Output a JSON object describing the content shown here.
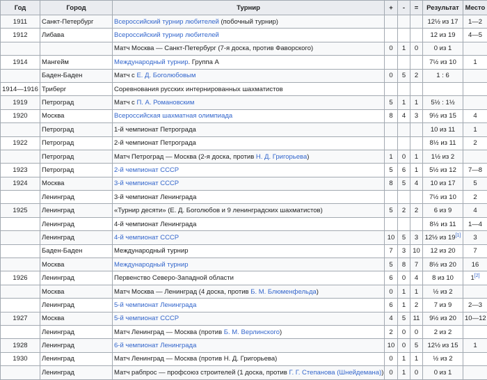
{
  "table": {
    "headers": [
      "Год",
      "Город",
      "Турнир",
      "+",
      "-",
      "=",
      "Результат",
      "Место"
    ],
    "rows": [
      {
        "year": "1911",
        "city": "Санкт-Петербург",
        "tournament": [
          {
            "t": "Всероссийский турнир любителей",
            "link": true
          },
          {
            "t": " (побочный турнир)"
          }
        ],
        "plus": "",
        "minus": "",
        "eq": "",
        "result": "12½ из 17",
        "place": [
          {
            "t": "1—2"
          }
        ]
      },
      {
        "year": "1912",
        "city": "Либава",
        "tournament": [
          {
            "t": "Всероссийский турнир любителей",
            "link": true
          }
        ],
        "plus": "",
        "minus": "",
        "eq": "",
        "result": "12 из 19",
        "place": [
          {
            "t": "4—5"
          }
        ]
      },
      {
        "year": "",
        "city": "",
        "tournament": [
          {
            "t": "Матч Москва — Санкт-Петербург (7-я доска, против Фаворского)"
          }
        ],
        "plus": "0",
        "minus": "1",
        "eq": "0",
        "result": "0 из 1",
        "place": [
          {
            "t": ""
          }
        ]
      },
      {
        "year": "1914",
        "city": "Мангейм",
        "tournament": [
          {
            "t": "Международный турнир",
            "link": true
          },
          {
            "t": ". Группа А"
          }
        ],
        "plus": "",
        "minus": "",
        "eq": "",
        "result": "7½ из 10",
        "place": [
          {
            "t": "1"
          }
        ]
      },
      {
        "year": "",
        "city": "Баден-Баден",
        "tournament": [
          {
            "t": "Матч с "
          },
          {
            "t": "Е. Д. Боголюбовым",
            "link": true
          }
        ],
        "plus": "0",
        "minus": "5",
        "eq": "2",
        "result": "1 : 6",
        "place": [
          {
            "t": ""
          }
        ]
      },
      {
        "year": "1914—1916",
        "city": "Триберг",
        "tournament": [
          {
            "t": "Соревнования русских интернированных шахматистов"
          }
        ],
        "plus": "",
        "minus": "",
        "eq": "",
        "result": "",
        "place": [
          {
            "t": ""
          }
        ]
      },
      {
        "year": "1919",
        "city": "Петроград",
        "tournament": [
          {
            "t": "Матч с "
          },
          {
            "t": "П. А. Романовским",
            "link": true
          }
        ],
        "plus": "5",
        "minus": "1",
        "eq": "1",
        "result": "5½ : 1½",
        "place": [
          {
            "t": ""
          }
        ]
      },
      {
        "year": "1920",
        "city": "Москва",
        "tournament": [
          {
            "t": "Всероссийская шахматная олимпиада",
            "link": true
          }
        ],
        "plus": "8",
        "minus": "4",
        "eq": "3",
        "result": "9½ из 15",
        "place": [
          {
            "t": "4"
          }
        ]
      },
      {
        "year": "",
        "city": "Петроград",
        "tournament": [
          {
            "t": "1-й чемпионат Петрограда"
          }
        ],
        "plus": "",
        "minus": "",
        "eq": "",
        "result": "10 из 11",
        "place": [
          {
            "t": "1"
          }
        ]
      },
      {
        "year": "1922",
        "city": "Петроград",
        "tournament": [
          {
            "t": "2-й чемпионат Петрограда"
          }
        ],
        "plus": "",
        "minus": "",
        "eq": "",
        "result": "8½ из 11",
        "place": [
          {
            "t": "2"
          }
        ]
      },
      {
        "year": "",
        "city": "Петроград",
        "tournament": [
          {
            "t": "Матч Петроград — Москва (2-я доска, против "
          },
          {
            "t": "Н. Д. Григорьева",
            "link": true
          },
          {
            "t": ")"
          }
        ],
        "plus": "1",
        "minus": "0",
        "eq": "1",
        "result": "1½ из 2",
        "place": [
          {
            "t": ""
          }
        ]
      },
      {
        "year": "1923",
        "city": "Петроград",
        "tournament": [
          {
            "t": "2-й чемпионат СССР",
            "link": true
          }
        ],
        "plus": "5",
        "minus": "6",
        "eq": "1",
        "result": "5½ из 12",
        "place": [
          {
            "t": "7—8"
          }
        ]
      },
      {
        "year": "1924",
        "city": "Москва",
        "tournament": [
          {
            "t": "3-й чемпионат СССР",
            "link": true
          }
        ],
        "plus": "8",
        "minus": "5",
        "eq": "4",
        "result": "10 из 17",
        "place": [
          {
            "t": "5"
          }
        ]
      },
      {
        "year": "",
        "city": "Ленинград",
        "tournament": [
          {
            "t": "3-й чемпионат Ленинграда"
          }
        ],
        "plus": "",
        "minus": "",
        "eq": "",
        "result": "7½ из 10",
        "place": [
          {
            "t": "2"
          }
        ]
      },
      {
        "year": "1925",
        "city": "Ленинград",
        "tournament": [
          {
            "t": "«Турнир десяти» (Е. Д. Боголюбов и 9 ленинградских шахматистов)"
          }
        ],
        "plus": "5",
        "minus": "2",
        "eq": "2",
        "result": "6 из 9",
        "place": [
          {
            "t": "4"
          }
        ]
      },
      {
        "year": "",
        "city": "Ленинград",
        "tournament": [
          {
            "t": "4-й чемпионат Ленинграда"
          }
        ],
        "plus": "",
        "minus": "",
        "eq": "",
        "result": "8½ из 11",
        "place": [
          {
            "t": "1—4"
          }
        ]
      },
      {
        "year": "",
        "city": "Ленинград",
        "tournament": [
          {
            "t": "4-й чемпионат СССР",
            "link": true
          }
        ],
        "plus": "10",
        "minus": "5",
        "eq": "3",
        "result": "12½ из 19",
        "result_ref": "[1]",
        "place": [
          {
            "t": "3"
          }
        ]
      },
      {
        "year": "",
        "city": "Баден-Баден",
        "tournament": [
          {
            "t": "Международный турнир"
          }
        ],
        "plus": "7",
        "minus": "3",
        "eq": "10",
        "result": "12 из 20",
        "place": [
          {
            "t": "7"
          }
        ]
      },
      {
        "year": "",
        "city": "Москва",
        "tournament": [
          {
            "t": "Международный турнир",
            "link": true
          }
        ],
        "plus": "5",
        "minus": "8",
        "eq": "7",
        "result": "8½ из 20",
        "place": [
          {
            "t": "16"
          }
        ]
      },
      {
        "year": "1926",
        "city": "Ленинград",
        "tournament": [
          {
            "t": "Первенство Северо-Западной области"
          }
        ],
        "plus": "6",
        "minus": "0",
        "eq": "4",
        "result": "8 из 10",
        "place": [
          {
            "t": "1"
          },
          {
            "t": "[2]",
            "ref": true
          }
        ]
      },
      {
        "year": "",
        "city": "Москва",
        "tournament": [
          {
            "t": "Матч Москва — Ленинград (4 доска, против "
          },
          {
            "t": "Б. М. Блюменфельда",
            "link": true
          },
          {
            "t": ")"
          }
        ],
        "plus": "0",
        "minus": "1",
        "eq": "1",
        "result": "½ из 2",
        "place": [
          {
            "t": ""
          }
        ]
      },
      {
        "year": "",
        "city": "Ленинград",
        "tournament": [
          {
            "t": "5-й чемпионат Ленинграда",
            "link": true
          }
        ],
        "plus": "6",
        "minus": "1",
        "eq": "2",
        "result": "7 из 9",
        "place": [
          {
            "t": "2—3"
          }
        ]
      },
      {
        "year": "1927",
        "city": "Москва",
        "tournament": [
          {
            "t": "5-й чемпионат СССР",
            "link": true
          }
        ],
        "plus": "4",
        "minus": "5",
        "eq": "11",
        "result": "9½ из 20",
        "place": [
          {
            "t": "10—12"
          }
        ]
      },
      {
        "year": "",
        "city": "Ленинград",
        "tournament": [
          {
            "t": "Матч Ленинград — Москва (против "
          },
          {
            "t": "Б. М. Верлинского",
            "link": true
          },
          {
            "t": ")"
          }
        ],
        "plus": "2",
        "minus": "0",
        "eq": "0",
        "result": "2 из 2",
        "place": [
          {
            "t": ""
          }
        ]
      },
      {
        "year": "1928",
        "city": "Ленинград",
        "tournament": [
          {
            "t": "6-й чемпионат Ленинграда",
            "link": true
          }
        ],
        "plus": "10",
        "minus": "0",
        "eq": "5",
        "result": "12½ из 15",
        "place": [
          {
            "t": "1"
          }
        ]
      },
      {
        "year": "1930",
        "city": "Ленинград",
        "tournament": [
          {
            "t": "Матч Ленинград — Москва (против Н. Д. Григорьева)"
          }
        ],
        "plus": "0",
        "minus": "1",
        "eq": "1",
        "result": "½ из 2",
        "place": [
          {
            "t": ""
          }
        ]
      },
      {
        "year": "",
        "city": "Ленинград",
        "tournament": [
          {
            "t": "Матч рабпрос — профсоюз строителей (1 доска, против "
          },
          {
            "t": "Г. Г. Степанова (Шнейдемана)",
            "link": true
          },
          {
            "t": ")"
          }
        ],
        "plus": "0",
        "minus": "1",
        "eq": "0",
        "result": "0 из 1",
        "place": [
          {
            "t": ""
          }
        ]
      }
    ]
  }
}
